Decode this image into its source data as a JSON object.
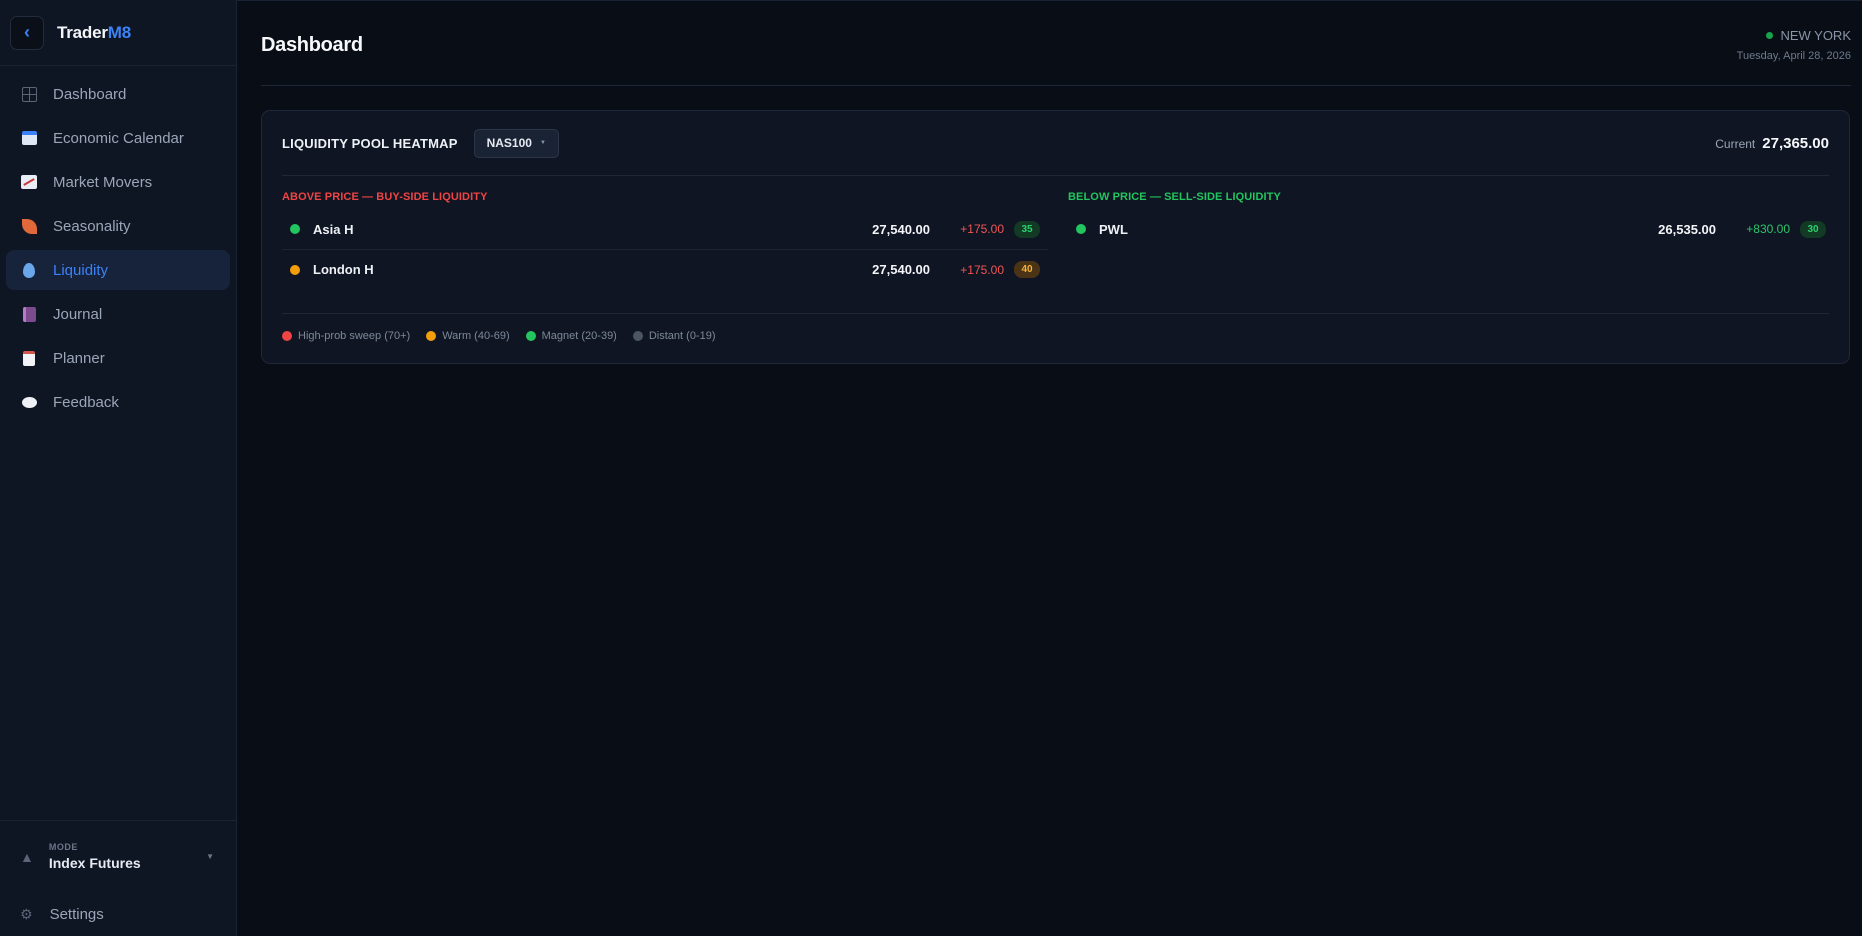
{
  "brand": {
    "name_main": "Trader",
    "name_accent": "M8",
    "collapse_glyph": "‹"
  },
  "sidebar": {
    "items": [
      {
        "label": "Dashboard",
        "icon": "grid-icon",
        "active": false
      },
      {
        "label": "Economic Calendar",
        "icon": "calendar-icon",
        "active": false
      },
      {
        "label": "Market Movers",
        "icon": "chart-icon",
        "active": false
      },
      {
        "label": "Seasonality",
        "icon": "leaf-icon",
        "active": false
      },
      {
        "label": "Liquidity",
        "icon": "droplet-icon",
        "active": true
      },
      {
        "label": "Journal",
        "icon": "book-icon",
        "active": false
      },
      {
        "label": "Planner",
        "icon": "notepad-icon",
        "active": false
      },
      {
        "label": "Feedback",
        "icon": "speech-bubble-icon",
        "active": false
      }
    ],
    "mode": {
      "label": "MODE",
      "value": "Index Futures",
      "icon": "triangle-icon"
    },
    "settings_label": "Settings"
  },
  "header": {
    "title": "Dashboard",
    "city": "NEW YORK",
    "date": "Tuesday, April 28, 2026",
    "status_color": "#16a34a"
  },
  "heatmap": {
    "title": "LIQUIDITY POOL HEATMAP",
    "symbol": "NAS100",
    "current_label": "Current",
    "current_value": "27,365.00",
    "above": {
      "heading": "ABOVE PRICE — BUY-SIDE LIQUIDITY",
      "rows": [
        {
          "name": "Asia H",
          "price": "27,540.00",
          "distance": "+175.00",
          "score": "35",
          "dot_color": "#22c55e"
        },
        {
          "name": "London H",
          "price": "27,540.00",
          "distance": "+175.00",
          "score": "40",
          "dot_color": "#f59e0b"
        }
      ]
    },
    "below": {
      "heading": "BELOW PRICE — SELL-SIDE LIQUIDITY",
      "rows": [
        {
          "name": "PWL",
          "price": "26,535.00",
          "distance": "+830.00",
          "score": "30",
          "dot_color": "#22c55e"
        }
      ]
    },
    "legend": [
      {
        "label": "High-prob sweep (70+)",
        "color": "#ef4444"
      },
      {
        "label": "Warm (40-69)",
        "color": "#f59e0b"
      },
      {
        "label": "Magnet (20-39)",
        "color": "#22c55e"
      },
      {
        "label": "Distant (0-19)",
        "color": "#4b5563"
      }
    ]
  }
}
